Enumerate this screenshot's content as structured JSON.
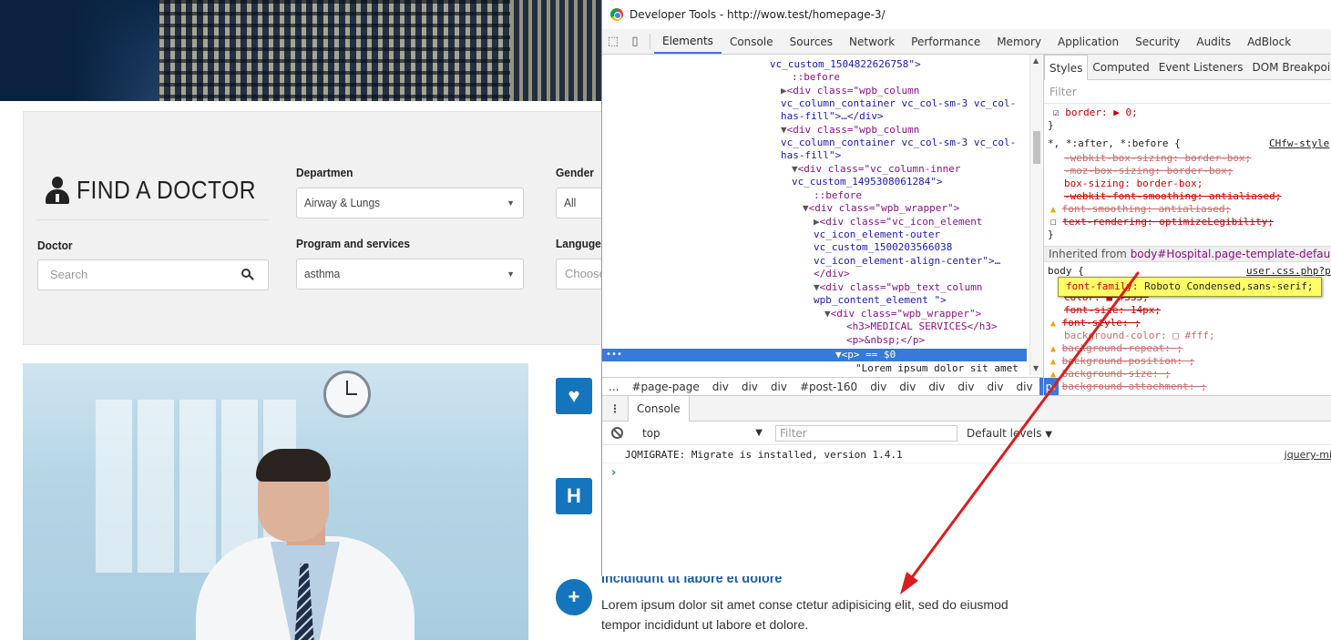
{
  "website": {
    "finder": {
      "title": "FIND A DOCTOR",
      "department_label": "Departmen",
      "department_value": "Airway & Lungs",
      "gender_label": "Gender",
      "gender_value": "All",
      "doctor_label": "Doctor",
      "doctor_placeholder": "Search",
      "program_label": "Program and services",
      "program_value": "asthma",
      "language_label": "Languge",
      "language_placeholder": "Choose"
    },
    "service": {
      "title": "incididunt ut labore et dolore",
      "text": "Lorem ipsum dolor sit amet conse ctetur adipisicing elit, sed do eiusmod tempor incididunt ut labore et dolore.",
      "h_glyph": "H",
      "heart_glyph": "♥",
      "ambulance_glyph": "+"
    },
    "brand_color": "#1475bd"
  },
  "devtools": {
    "window_title": "Developer Tools - http://wow.test/homepage-3/",
    "tabs": [
      "Elements",
      "Console",
      "Sources",
      "Network",
      "Performance",
      "Memory",
      "Application",
      "Security",
      "Audits",
      "AdBlock"
    ],
    "active_tab": "Elements",
    "dom_lines": [
      "vc_custom_1504822626758\">",
      "::before",
      "<div class=\"wpb_column",
      "vc_column_container vc_col-sm-3 vc_col-",
      "has-fill\">…</div>",
      "<div class=\"wpb_column",
      "vc_column_container vc_col-sm-3 vc_col-",
      "has-fill\">",
      "<div class=\"vc_column-inner",
      "vc_custom_1495308061284\">",
      "::before",
      "<div class=\"wpb_wrapper\">",
      "<div class=\"vc_icon_element",
      "vc_icon_element-outer",
      "vc_custom_1500203566038",
      "vc_icon_element-align-center\">…",
      "</div>",
      "<div class=\"wpb_text_column",
      "wpb_content_element \">",
      "<div class=\"wpb_wrapper\">",
      "<h3>MEDICAL SERVICES</h3>",
      "<p>&nbsp;</p>",
      "<p> == $0",
      "\"Lorem ipsum dolor sit amet"
    ],
    "breadcrumbs": [
      "...",
      "#page-page",
      "div",
      "div",
      "div",
      "#post-160",
      "div",
      "div",
      "div",
      "div",
      "div",
      "div",
      "p"
    ],
    "styles_tabs": [
      "Styles",
      "Computed",
      "Event Listeners",
      "DOM Breakpoints"
    ],
    "styles_filter": "Filter",
    "styles_lines": {
      "border": "border: ▶ 0;",
      "close1": "}",
      "universal_selector": "*, *:after, *:before {",
      "universal_source": "CHfw-style",
      "webkit_box": "-webkit-box-sizing: border-box;",
      "moz_box": "-moz-box-sizing: border-box;",
      "box_sizing": "box-sizing: border-box;",
      "webkit_font": "-webkit-font-smoothing: antialiased;",
      "font_smoothing": "font-smoothing: antialiased;",
      "text_rendering": "text-rendering: optimizeLegibility;",
      "close2": "}",
      "inherited_label": "Inherited from",
      "inherited_selector": "body#Hospital.page-template-default",
      "body_selector": "body {",
      "body_source": "user.css.php?p",
      "color": "color: ■ #333;",
      "font_size": "font-size: 14px;",
      "font_style": "font-style: ;",
      "bg_color": "background-color: □ #fff;",
      "bg_repeat": "background-repeat: ;",
      "bg_position": "background-position: ;",
      "bg_size": "background-size: ;",
      "bg_attachment": "background-attachment: ;"
    },
    "tooltip": {
      "property": "font-family:",
      "value": "Roboto Condensed,sans-serif;"
    },
    "console": {
      "tab": "Console",
      "context": "top",
      "filter_placeholder": "Filter",
      "levels": "Default levels",
      "message": "JQMIGRATE: Migrate is installed, version 1.4.1",
      "source": "jquery-mi",
      "prompt": "›"
    },
    "selection_color": "#3879d9",
    "annotation_arrow_color": "#d81e1e"
  }
}
